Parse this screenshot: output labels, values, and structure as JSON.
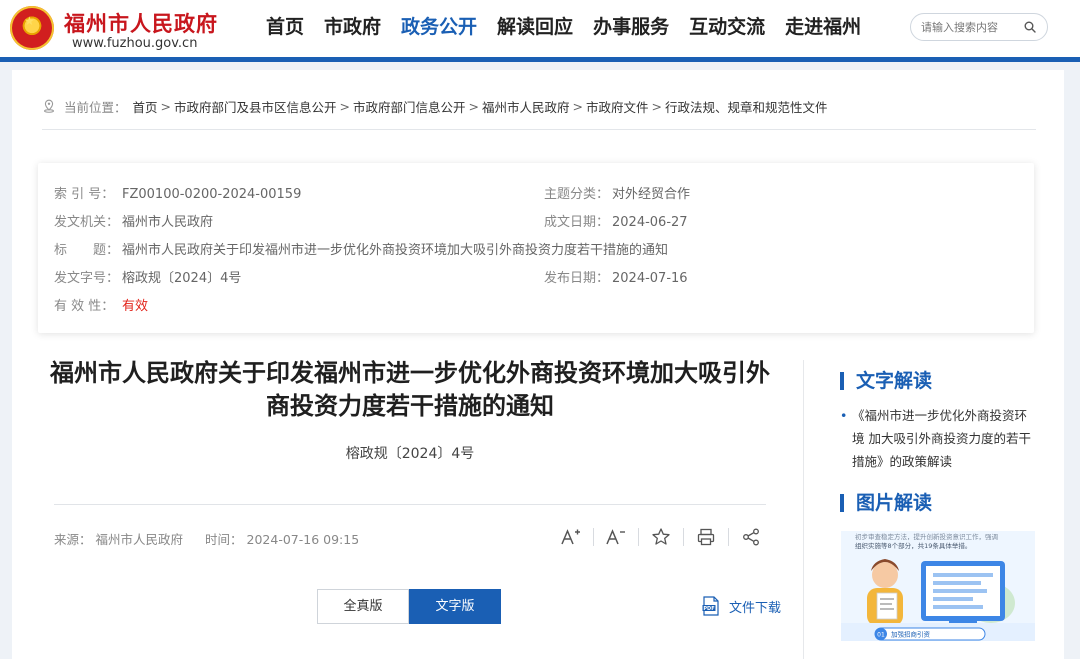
{
  "header": {
    "site_name": "福州市人民政府",
    "site_url": "www.fuzhou.gov.cn",
    "nav": [
      {
        "label": "首页",
        "active": false
      },
      {
        "label": "市政府",
        "active": false
      },
      {
        "label": "政务公开",
        "active": true
      },
      {
        "label": "解读回应",
        "active": false
      },
      {
        "label": "办事服务",
        "active": false
      },
      {
        "label": "互动交流",
        "active": false
      },
      {
        "label": "走进福州",
        "active": false
      }
    ],
    "search_placeholder": "请输入搜索内容"
  },
  "breadcrumb": {
    "prefix": "当前位置：",
    "items": [
      "首页",
      "市政府部门及县市区信息公开",
      "市政府部门信息公开",
      "福州市人民政府",
      "市政府文件",
      "行政法规、规章和规范性文件"
    ],
    "sep": ">"
  },
  "meta": {
    "index_label": "索 引 号：",
    "index_value": "FZ00100-0200-2024-00159",
    "topic_label": "主题分类：",
    "topic_value": "对外经贸合作",
    "issuer_label": "发文机关：",
    "issuer_value": "福州市人民政府",
    "date_label": "成文日期：",
    "date_value": "2024-06-27",
    "title_label": "标　　题：",
    "title_value": "福州市人民政府关于印发福州市进一步优化外商投资环境加大吸引外商投资力度若干措施的通知",
    "docno_label": "发文字号：",
    "docno_value": "榕政规〔2024〕4号",
    "pub_label": "发布日期：",
    "pub_value": "2024-07-16",
    "valid_label": "有 效 性：",
    "valid_value": "有效"
  },
  "article": {
    "title": "福州市人民政府关于印发福州市进一步优化外商投资环境加大吸引外商投资力度若干措施的通知",
    "doc_number": "榕政规〔2024〕4号",
    "source_label": "来源：",
    "source_value": "福州市人民政府",
    "time_label": "时间：",
    "time_value": "2024-07-16 09:15",
    "view_full": "全真版",
    "view_text": "文字版",
    "download_label": "文件下载"
  },
  "sidebar": {
    "text_head": "文字解读",
    "text_link": "《福州市进一步优化外商投资环境 加大吸引外商投资力度的若干措施》的政策解读",
    "image_head": "图片解读",
    "image_caption_top": "组织实施等8个部分，共19条具体举措。",
    "image_tag": "01 加强招商引资"
  },
  "colors": {
    "brand_blue": "#1a5fb4",
    "brand_red": "#c8161d",
    "valid_red": "#e2231a"
  }
}
